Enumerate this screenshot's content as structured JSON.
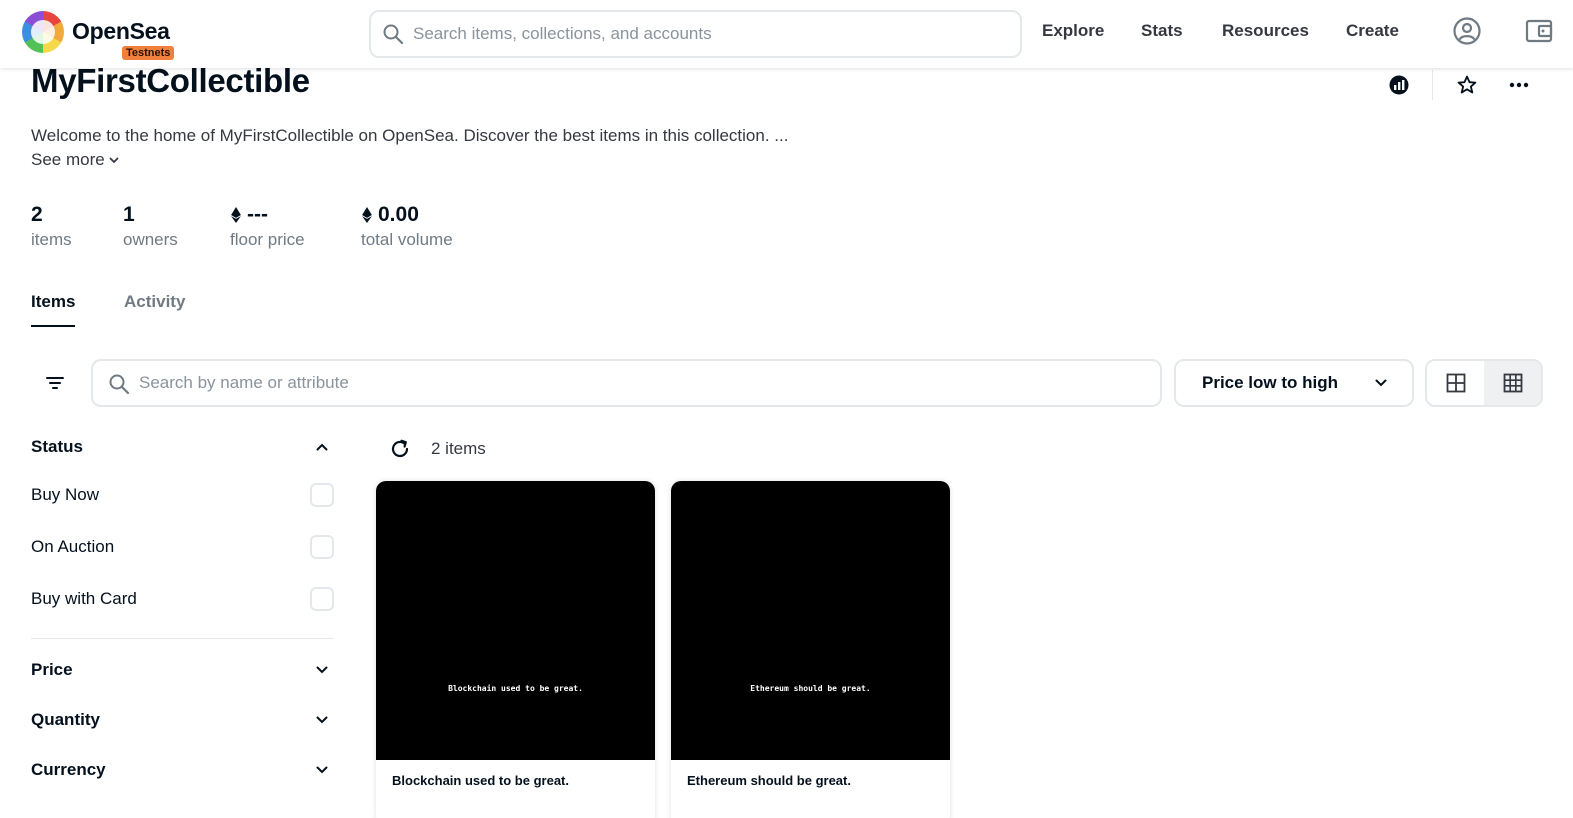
{
  "topbar": {
    "brand": "OpenSea",
    "badge": "Testnets",
    "search_placeholder": "Search items, collections, and accounts",
    "nav": [
      "Explore",
      "Stats",
      "Resources",
      "Create"
    ],
    "icons": [
      "account-icon",
      "wallet-icon"
    ]
  },
  "collection": {
    "title": "MyFirstCollectible",
    "description": "Welcome to the home of MyFirstCollectible on OpenSea. Discover the best items in this collection. ...",
    "see_more": "See more",
    "stats": [
      {
        "value": "2",
        "label": "items"
      },
      {
        "value": "1",
        "label": "owners"
      },
      {
        "value": "---",
        "label": "floor price",
        "currency": "eth"
      },
      {
        "value": "0.00",
        "label": "total volume",
        "currency": "eth"
      }
    ],
    "header_icons": [
      "activity-chart-icon",
      "star-icon",
      "more-icon"
    ]
  },
  "tabs": [
    "Items",
    "Activity"
  ],
  "active_tab": "Items",
  "toolbar": {
    "search_placeholder": "Search by name or attribute",
    "sort_label": "Price low to high"
  },
  "sidebar": {
    "status_title": "Status",
    "status_options": [
      "Buy Now",
      "On Auction",
      "Buy with Card"
    ],
    "sections": [
      "Price",
      "Quantity",
      "Currency"
    ]
  },
  "results": {
    "count_label": "2 items",
    "items": [
      {
        "image_text": "Blockchain used to be great.",
        "name": "Blockchain used to be great."
      },
      {
        "image_text": "Ethereum should be great.",
        "name": "Ethereum should be great."
      }
    ]
  },
  "colors": {
    "text": "#04111d",
    "muted": "#707a83",
    "border": "#e5e8eb",
    "badge": "#f0803c"
  }
}
